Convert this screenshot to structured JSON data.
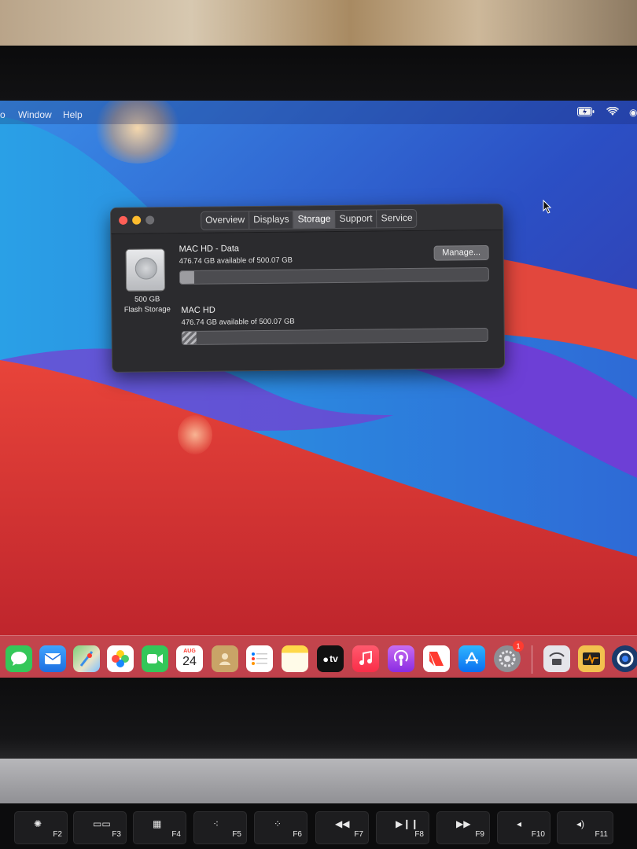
{
  "menubar": {
    "items": [
      "o",
      "Window",
      "Help"
    ]
  },
  "window": {
    "tabs": [
      {
        "label": "Overview",
        "selected": false
      },
      {
        "label": "Displays",
        "selected": false
      },
      {
        "label": "Storage",
        "selected": true
      },
      {
        "label": "Support",
        "selected": false
      },
      {
        "label": "Service",
        "selected": false
      }
    ],
    "drive": {
      "capacity": "500 GB",
      "type": "Flash Storage"
    },
    "manage_label": "Manage...",
    "volumes": [
      {
        "name": "MAC HD - Data",
        "available": "476.74 GB available of 500.07 GB",
        "used_fraction": 0.047
      },
      {
        "name": "MAC HD",
        "available": "476.74 GB available of 500.07 GB",
        "used_fraction": 0.047
      }
    ]
  },
  "dock": {
    "calendar_month": "AUG",
    "calendar_day": "24",
    "appletv_label": "tv",
    "system_prefs_badge": "1",
    "icons": [
      "messages-icon",
      "mail-icon",
      "maps-icon",
      "photos-icon",
      "facetime-icon",
      "calendar-icon",
      "contacts-icon",
      "reminders-icon",
      "notes-icon",
      "apple-tv-icon",
      "music-icon",
      "podcasts-icon",
      "news-icon",
      "app-store-icon",
      "system-preferences-icon",
      "network-utility-icon",
      "activity-monitor-icon",
      "cinema4d-icon"
    ]
  },
  "keyboard": {
    "keys": [
      "F2",
      "F3",
      "F4",
      "F5",
      "F6",
      "F7",
      "F8",
      "F9",
      "F10",
      "F11"
    ]
  },
  "colors": {
    "close": "#ff5f57",
    "minimize": "#febc2e",
    "zoom_inactive": "#6e6e72",
    "window_bg": "#2b2b2e"
  }
}
